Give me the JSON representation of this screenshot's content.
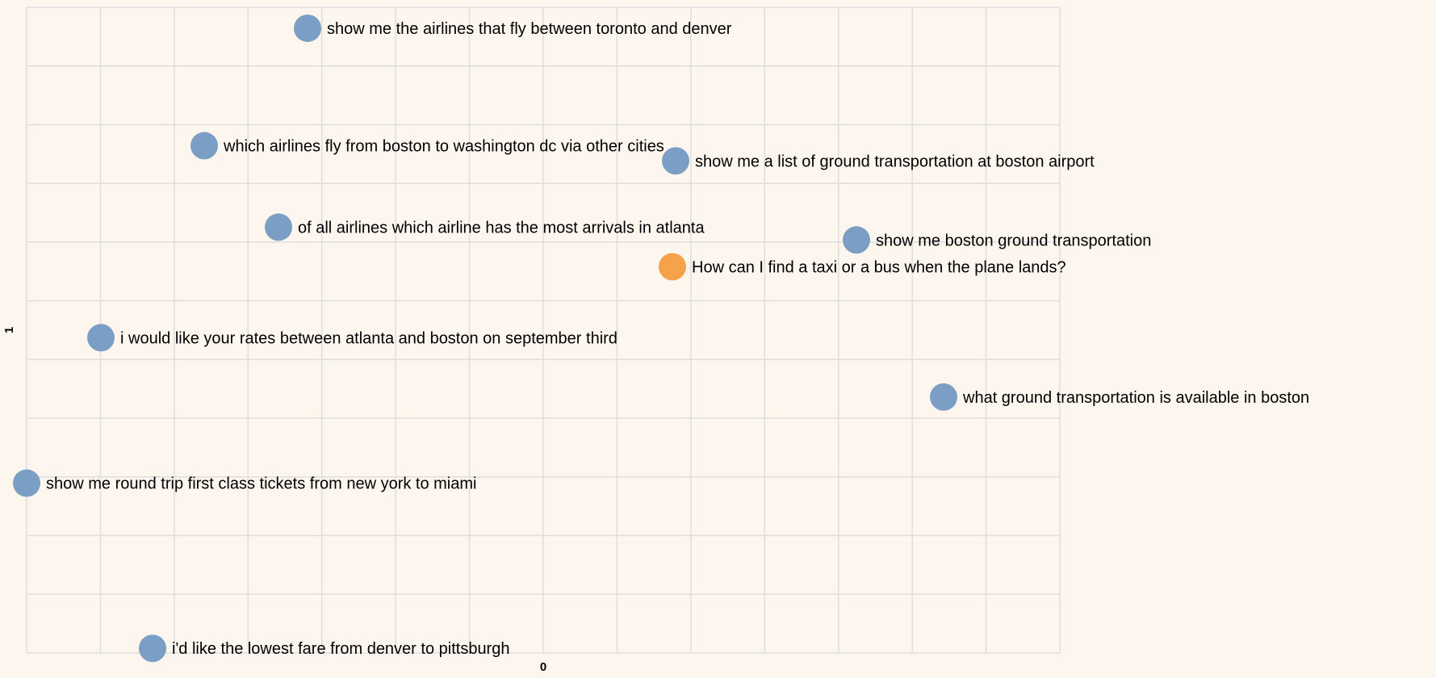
{
  "chart_data": {
    "type": "scatter",
    "title": "",
    "xlabel": "0",
    "ylabel": "1",
    "grid": true,
    "xlim": [
      -0.05,
      0.59
    ],
    "ylim": [
      -0.03,
      0.525
    ],
    "grid_cols": 14,
    "grid_rows": 11,
    "colors": {
      "background": "#fdf6ee",
      "grid": "#dddddd",
      "point_default": "#7b9ec4",
      "point_query": "#f5a24b",
      "label": "#000000"
    },
    "points": [
      {
        "x": 0.124,
        "y": 0.507,
        "label": "show me the airlines that fly between toronto and denver",
        "kind": "default"
      },
      {
        "x": 0.06,
        "y": 0.406,
        "label": "which airlines fly from boston to washington dc via other cities",
        "kind": "default"
      },
      {
        "x": 0.352,
        "y": 0.393,
        "label": "show me a list of ground transportation at boston airport",
        "kind": "default"
      },
      {
        "x": 0.106,
        "y": 0.336,
        "label": "of all airlines which airline has the most arrivals in atlanta",
        "kind": "default"
      },
      {
        "x": 0.464,
        "y": 0.325,
        "label": "show me boston ground transportation",
        "kind": "default"
      },
      {
        "x": 0.35,
        "y": 0.302,
        "label": "How can I find a taxi or a bus when the plane lands?",
        "kind": "query"
      },
      {
        "x": -0.004,
        "y": 0.241,
        "label": "i would like your rates between atlanta and boston on september third",
        "kind": "default"
      },
      {
        "x": 0.518,
        "y": 0.19,
        "label": "what ground transportation is available in boston",
        "kind": "default"
      },
      {
        "x": -0.05,
        "y": 0.116,
        "label": "show me round trip first class tickets from new york to miami",
        "kind": "default"
      },
      {
        "x": 0.028,
        "y": -0.026,
        "label": "i'd like the lowest fare from denver to pittsburgh",
        "kind": "default"
      }
    ]
  }
}
